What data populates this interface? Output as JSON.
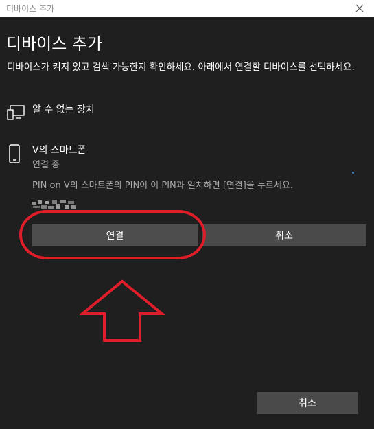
{
  "window": {
    "title": "디바이스 추가"
  },
  "dialog": {
    "heading": "디바이스 추가",
    "description": "디바이스가 켜져 있고 검색 가능한지 확인하세요. 아래에서 연결할 디바이스를 선택하세요."
  },
  "devices": [
    {
      "icon": "display-device-icon",
      "label": "알 수 없는 장치"
    },
    {
      "icon": "phone-icon",
      "label": "V의 스마트폰",
      "status": "연결 중",
      "pin_message": "PIN on V의 스마트폰의 PIN이 이 PIN과 일치하면 [연결]을 누르세요."
    }
  ],
  "buttons": {
    "connect": "연결",
    "cancel_inline": "취소",
    "cancel_bottom": "취소"
  },
  "colors": {
    "background": "#1f1f1f",
    "titlebar": "#ffffff",
    "button": "#4a4a4a",
    "annotation": "#e01e2a",
    "accent": "#3a8fd6"
  }
}
